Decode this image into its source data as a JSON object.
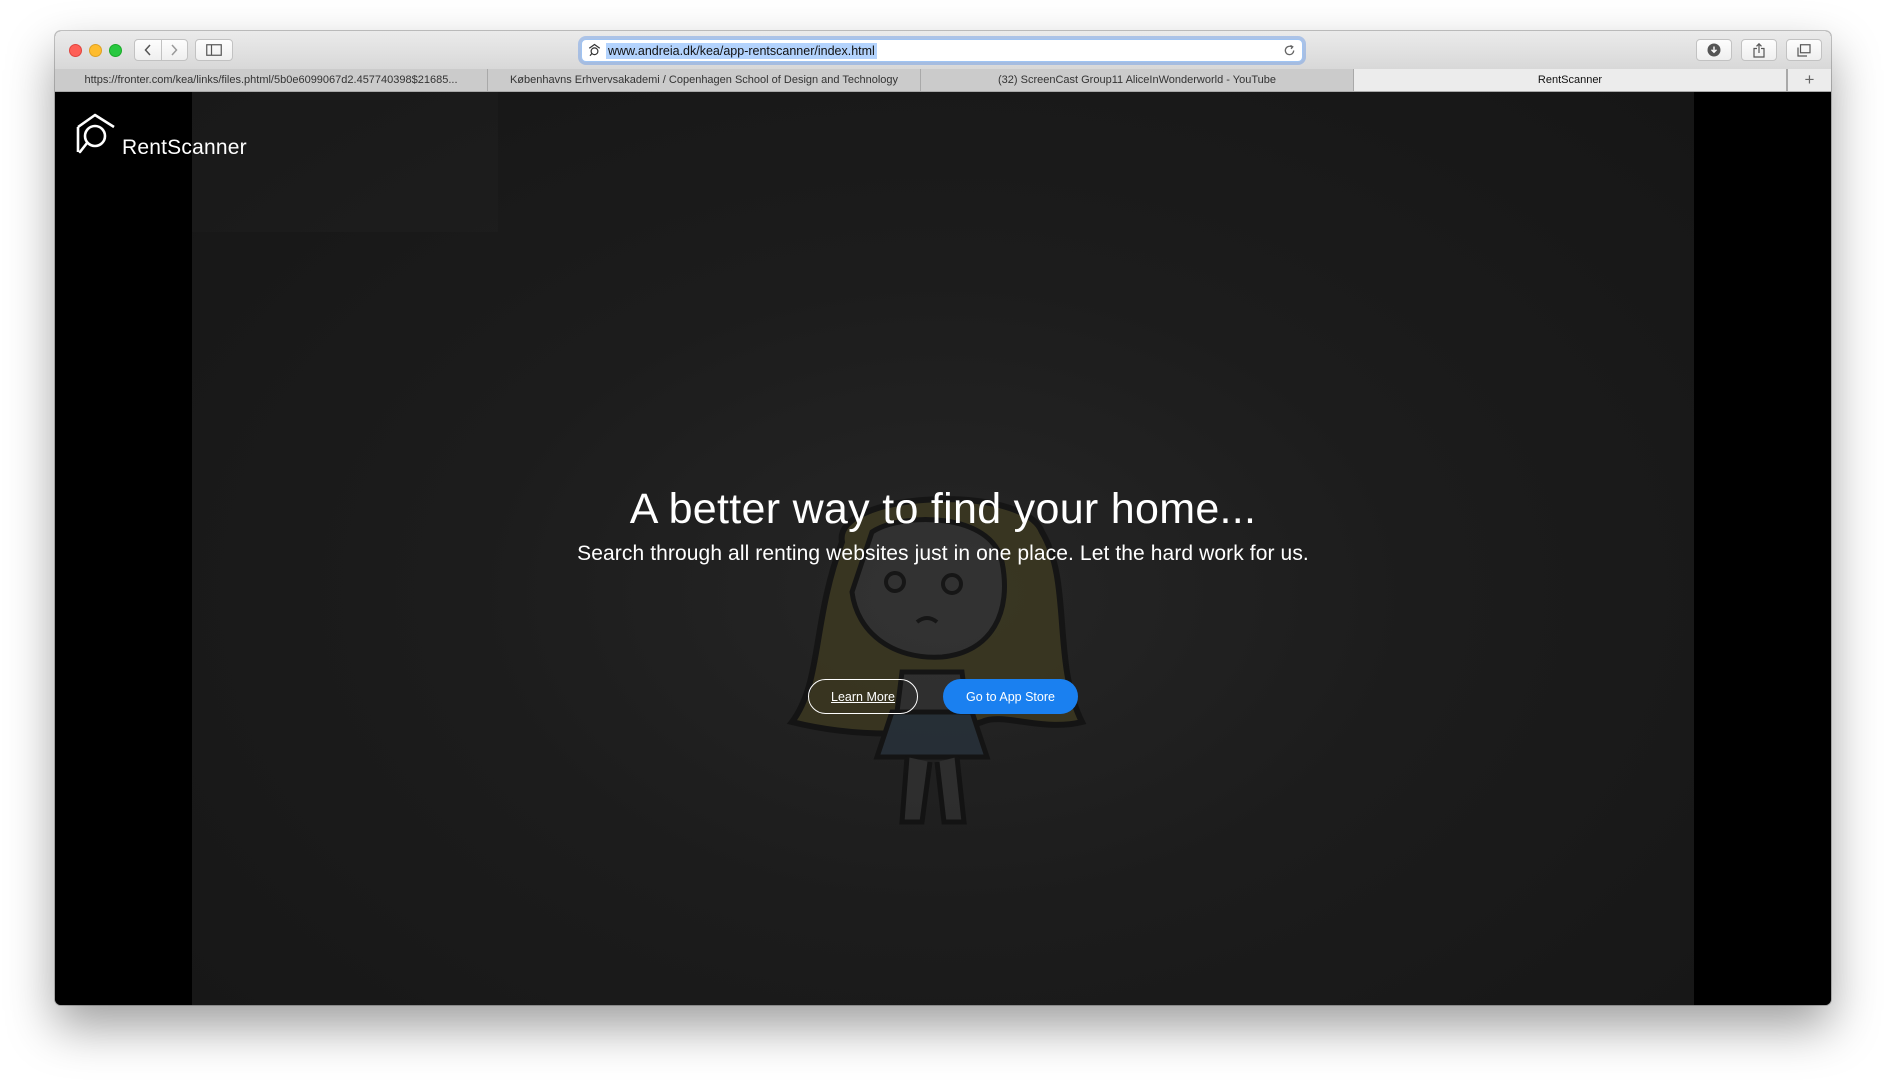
{
  "browser": {
    "url": "www.andreia.dk/kea/app-rentscanner/index.html",
    "tabs": [
      {
        "label": "https://fronter.com/kea/links/files.phtml/5b0e6099067d2.457740398$21685..."
      },
      {
        "label": "Københavns Erhvervsakademi / Copenhagen School of Design and Technology"
      },
      {
        "label": "(32) ScreenCast Group11 AliceInWonderworld - YouTube"
      },
      {
        "label": "RentScanner",
        "active": true
      }
    ],
    "new_tab_label": "+"
  },
  "page": {
    "brand": "RentScanner",
    "hero_title": "A better way to find your home...",
    "hero_subtitle": "Search through all renting websites just in one place. Let the hard work for us.",
    "learn_more_label": "Learn More",
    "app_store_label": "Go to App Store",
    "accent_color": "#1a80f0"
  }
}
